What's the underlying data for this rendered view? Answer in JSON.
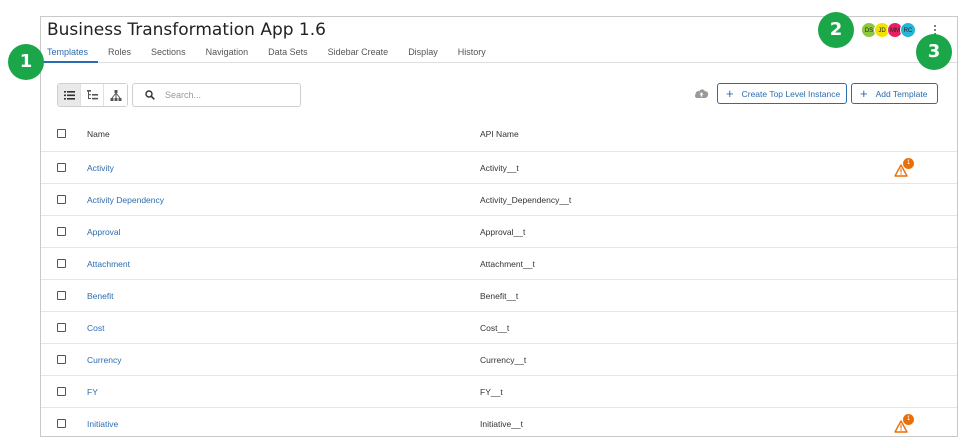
{
  "app": {
    "title": "Business Transformation App 1.6"
  },
  "tabs": [
    {
      "label": "Templates",
      "active": true
    },
    {
      "label": "Roles"
    },
    {
      "label": "Sections"
    },
    {
      "label": "Navigation"
    },
    {
      "label": "Data Sets"
    },
    {
      "label": "Sidebar Create"
    },
    {
      "label": "Display"
    },
    {
      "label": "History"
    }
  ],
  "avatars": [
    {
      "initials": "DS",
      "color": "#8dc63f"
    },
    {
      "initials": "JD",
      "color": "#f2e200"
    },
    {
      "initials": "MM",
      "color": "#e91e63"
    },
    {
      "initials": "RC",
      "color": "#26b5d6"
    }
  ],
  "toolbar": {
    "search_placeholder": "Search...",
    "create_top_level_label": "Create Top Level Instance",
    "add_template_label": "Add Template"
  },
  "table": {
    "headers": {
      "name": "Name",
      "api_name": "API Name"
    },
    "rows": [
      {
        "name": "Activity",
        "api": "Activity__t",
        "warning": "1"
      },
      {
        "name": "Activity Dependency",
        "api": "Activity_Dependency__t"
      },
      {
        "name": "Approval",
        "api": "Approval__t"
      },
      {
        "name": "Attachment",
        "api": "Attachment__t"
      },
      {
        "name": "Benefit",
        "api": "Benefit__t"
      },
      {
        "name": "Cost",
        "api": "Cost__t"
      },
      {
        "name": "Currency",
        "api": "Currency__t"
      },
      {
        "name": "FY",
        "api": "FY__t"
      },
      {
        "name": "Initiative",
        "api": "Initiative__t",
        "warning": "1"
      }
    ]
  },
  "markers": {
    "m1": "1",
    "m2": "2",
    "m3": "3"
  },
  "colors": {
    "accent": "#2b6cb0",
    "warning": "#e8700a",
    "marker": "#1ca64a"
  }
}
